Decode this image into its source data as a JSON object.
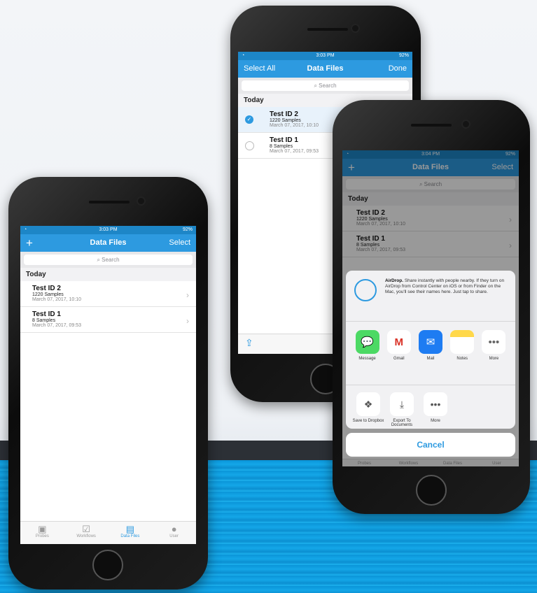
{
  "phones": {
    "left": {
      "status": {
        "time": "3:03 PM",
        "battery": "92%",
        "wifi": "wifi-icon"
      },
      "nav": {
        "left": "+",
        "title": "Data Files",
        "right": "Select"
      },
      "search": "Search",
      "section": "Today",
      "rows": [
        {
          "name": "Test ID 2",
          "samples": "1220 Samples",
          "date": "March 07, 2017, 10:10"
        },
        {
          "name": "Test ID 1",
          "samples": "8 Samples",
          "date": "March 07, 2017, 09:53"
        }
      ],
      "tabs": [
        "Probes",
        "Workflows",
        "Data Files",
        "User"
      ]
    },
    "middle": {
      "status": {
        "time": "3:03 PM",
        "battery": "92%"
      },
      "nav": {
        "left": "Select All",
        "title": "Data Files",
        "right": "Done"
      },
      "search": "Search",
      "section": "Today",
      "rows": [
        {
          "name": "Test ID 2",
          "samples": "1220 Samples",
          "date": "March 07, 2017, 10:10",
          "selected": true
        },
        {
          "name": "Test ID 1",
          "samples": "8 Samples",
          "date": "March 07, 2017, 09:53",
          "selected": false
        }
      ]
    },
    "right": {
      "status": {
        "time": "3:04 PM",
        "battery": "92%"
      },
      "nav": {
        "left": "+",
        "title": "Data Files",
        "right": "Select"
      },
      "search": "Search",
      "section": "Today",
      "rows": [
        {
          "name": "Test ID 2",
          "samples": "1220 Samples",
          "date": "March 07, 2017, 10:10"
        },
        {
          "name": "Test ID 1",
          "samples": "8 Samples",
          "date": "March 07, 2017, 09:53"
        }
      ],
      "share": {
        "airdrop_title": "AirDrop.",
        "airdrop_text": "Share instantly with people nearby. If they turn on AirDrop from Control Center on iOS or from Finder on the Mac, you'll see their names here. Just tap to share.",
        "apps": [
          "Message",
          "Gmail",
          "Mail",
          "Notes",
          "More"
        ],
        "actions": [
          "Save to Dropbox",
          "Export To Documents",
          "More"
        ],
        "cancel": "Cancel"
      },
      "tabs": [
        "Probes",
        "Workflows",
        "Data Files",
        "User"
      ]
    }
  },
  "colors": {
    "accent": "#2d9ae0",
    "status": "#1d86c7",
    "band": "#14a7e8"
  }
}
